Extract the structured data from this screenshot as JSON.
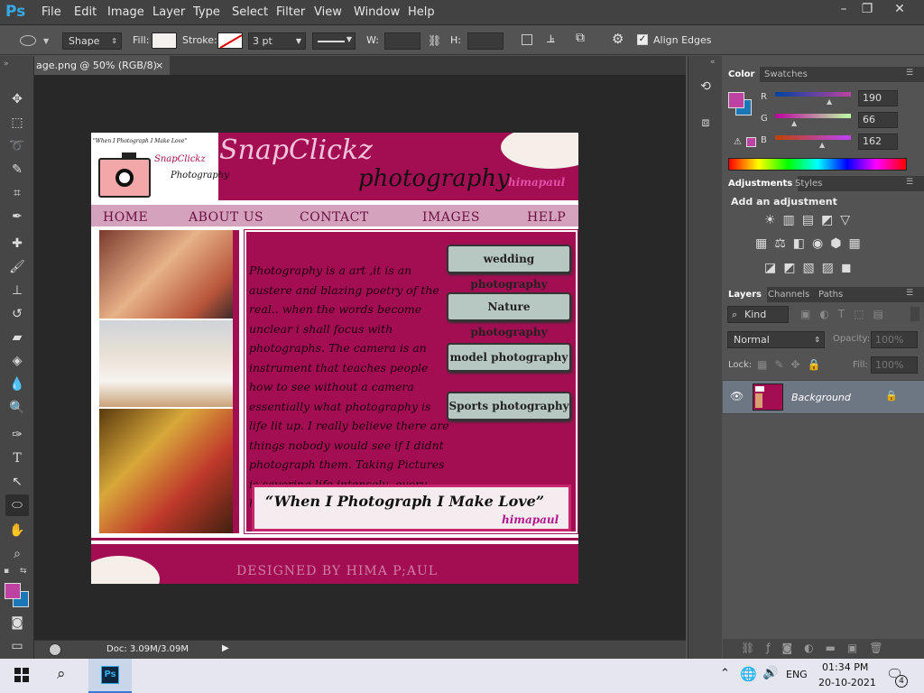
{
  "app": {
    "logo": "Ps"
  },
  "menu": [
    "File",
    "Edit",
    "Image",
    "Layer",
    "Type",
    "Select",
    "Filter",
    "View",
    "Window",
    "Help"
  ],
  "options_bar": {
    "mode": "Shape",
    "fill_label": "Fill:",
    "stroke_label": "Stroke:",
    "stroke_width": "3 pt",
    "w_label": "W:",
    "h_label": "H:",
    "align_edges_label": "Align Edges"
  },
  "document_tab": {
    "title": "age.png @ 50% (RGB/8)",
    "close": "×"
  },
  "status": {
    "doc_size": "Doc: 3.09M/3.09M"
  },
  "color_panel": {
    "tabs": [
      "Color",
      "Swatches"
    ],
    "r_label": "R",
    "g_label": "G",
    "b_label": "B",
    "r": "190",
    "g": "66",
    "b": "162",
    "r_level": 0.745,
    "g_level": 0.259,
    "b_level": 0.635,
    "foreground": "#be42a2",
    "background": "#1a78b8"
  },
  "adjustments_panel": {
    "tabs": [
      "Adjustments",
      "Styles"
    ],
    "heading": "Add an adjustment"
  },
  "layers_panel": {
    "tabs": [
      "Layers",
      "Channels",
      "Paths"
    ],
    "kind": "Kind",
    "blend_mode": "Normal",
    "opacity_label": "Opacity:",
    "opacity": "100%",
    "lock_label": "Lock:",
    "fill_label": "Fill:",
    "fill": "100%",
    "layer_name": "Background"
  },
  "design": {
    "brand": "SnapClickz",
    "brand_sub": "photography",
    "author": "himapaul",
    "logo_quote": "\"When I Photograph I Make Love\"",
    "logo_brand": "SnapClickz",
    "logo_sub": "Photography",
    "nav": [
      "HOME",
      "ABOUT US",
      "CONTACT",
      "IMAGES",
      "HELP"
    ],
    "body_text": "Photography is a art ,it is an austere and blazing poetry of the real.. when the words become unclear i shall focus with photographs. The camera is an instrument that teaches people how to see without a camera essentially what photography is life lit up. I really believe there are things nobody would see if I didnt photograph them. Taking Pictures is savoring life intensely ,every hundredth of a second",
    "buttons": [
      "wedding photography",
      "Nature photography",
      "model photography",
      "Sports photography"
    ],
    "quote": "“When I Photograph I Make Love”",
    "quote_author": "himapaul",
    "footer": "DESIGNED BY  HIMA P;AUL",
    "accent": "#a30d52",
    "nav_bg": "#d4a2bd"
  },
  "taskbar": {
    "time": "01:34 PM",
    "date": "20-10-2021",
    "lang": "ENG",
    "notif_count": "4",
    "ps_label": "Ps"
  }
}
